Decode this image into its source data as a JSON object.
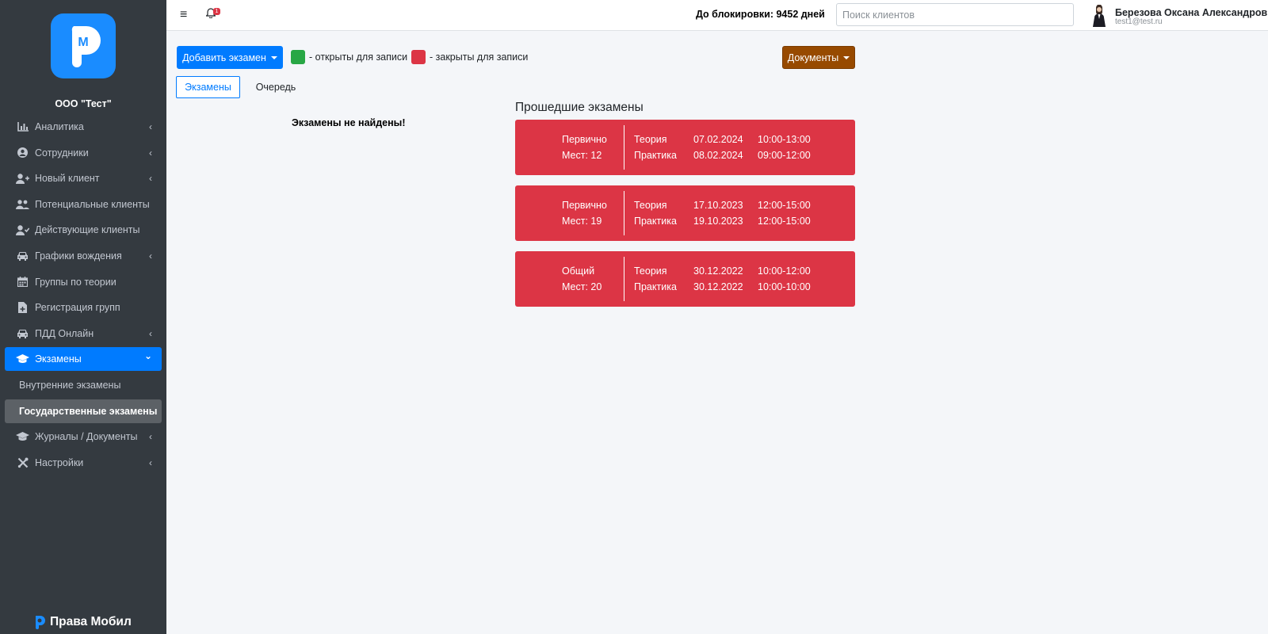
{
  "sidebar": {
    "org_name": "ООО \"Тест\"",
    "brand": "Права Мобил",
    "items": [
      {
        "label": "Аналитика",
        "icon": "chart-icon",
        "arrow": "‹"
      },
      {
        "label": "Сотрудники",
        "icon": "user-circle-icon",
        "arrow": "‹"
      },
      {
        "label": "Новый клиент",
        "icon": "user-plus-icon",
        "arrow": "‹"
      },
      {
        "label": "Потенциальные клиенты",
        "icon": "users-icon",
        "arrow": ""
      },
      {
        "label": "Действующие клиенты",
        "icon": "user-check-icon",
        "arrow": ""
      },
      {
        "label": "Графики вождения",
        "icon": "car-icon",
        "arrow": "‹"
      },
      {
        "label": "Группы по теории",
        "icon": "calendar-icon",
        "arrow": ""
      },
      {
        "label": "Регистрация групп",
        "icon": "file-plus-icon",
        "arrow": ""
      },
      {
        "label": "ПДД Онлайн",
        "icon": "car-icon",
        "arrow": "‹"
      },
      {
        "label": "Экзамены",
        "icon": "graduation-cap-icon",
        "arrow": "⌄"
      },
      {
        "label": "Внутренние экзамены"
      },
      {
        "label": "Государственные экзамены"
      },
      {
        "label": "Журналы / Документы",
        "icon": "graduation-cap-icon",
        "arrow": "‹"
      },
      {
        "label": "Настройки",
        "icon": "tools-icon",
        "arrow": "‹"
      }
    ]
  },
  "topbar": {
    "burger": "≡",
    "notifications_count": "1",
    "block_info": "До блокировки: 9452 дней",
    "search_placeholder": "Поиск клиентов",
    "user_name": "Березова Оксана Александровна",
    "user_email": "test1@test.ru"
  },
  "toolbar": {
    "add_exam_label": "Добавить экзамен",
    "legend_open": "- открыты для записи",
    "legend_closed": "- закрыты для записи",
    "documents_label": "Документы"
  },
  "tabs": {
    "exams": "Экзамены",
    "queue": "Очередь"
  },
  "empty_message": "Экзамены не найдены!",
  "past_exams_title": "Прошедшие экзамены",
  "past_exams": [
    {
      "type": "Первично",
      "seats": "Мест: 12",
      "theory_label": "Теория",
      "theory_date": "07.02.2024",
      "theory_time": "10:00-13:00",
      "practice_label": "Практика",
      "practice_date": "08.02.2024",
      "practice_time": "09:00-12:00"
    },
    {
      "type": "Первично",
      "seats": "Мест: 19",
      "theory_label": "Теория",
      "theory_date": "17.10.2023",
      "theory_time": "12:00-15:00",
      "practice_label": "Практика",
      "practice_date": "19.10.2023",
      "practice_time": "12:00-15:00"
    },
    {
      "type": "Общий",
      "seats": "Мест: 20",
      "theory_label": "Теория",
      "theory_date": "30.12.2022",
      "theory_time": "10:00-12:00",
      "practice_label": "Практика",
      "practice_date": "30.12.2022",
      "practice_time": "10:00-10:00"
    }
  ],
  "colors": {
    "sidebar_bg": "#343a40",
    "primary": "#007bff",
    "open_status": "#28a745",
    "closed_status": "#dc3545",
    "documents_button": "#974a00"
  }
}
